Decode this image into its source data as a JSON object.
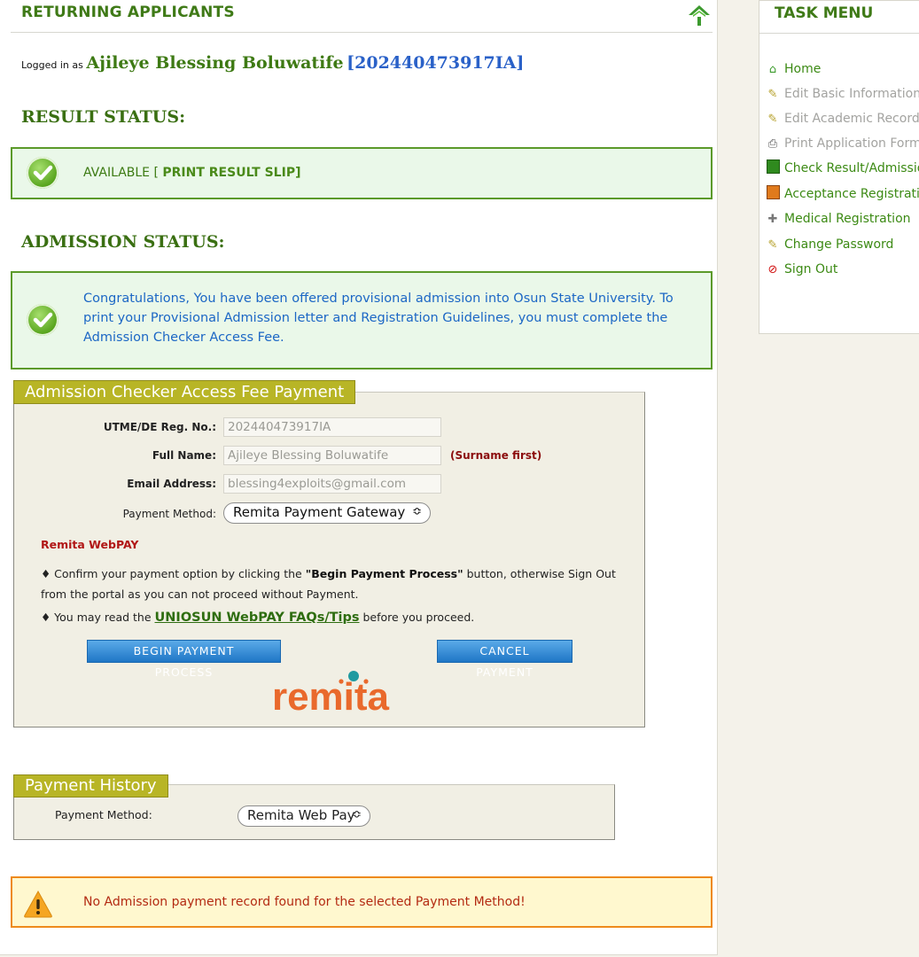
{
  "main": {
    "title": "RETURNING APPLICANTS",
    "logged_in_prefix": "Logged in as",
    "user_name": "Ajileye Blessing Boluwatife",
    "reg_no_display": "[202440473917IA]"
  },
  "result_status": {
    "heading": "RESULT STATUS:",
    "text": "AVAILABLE [",
    "link": "PRINT RESULT SLIP]"
  },
  "admission_status": {
    "heading": "ADMISSION STATUS:",
    "message": "Congratulations, You have been offered provisional admission into Osun State University. To print your Provisional Admission letter and Registration Guidelines, you must complete the Admission Checker Access Fee."
  },
  "fee_form": {
    "title": "Admission Checker Access Fee Payment",
    "reg_label": "UTME/DE Reg. No.:",
    "reg_value": "202440473917IA",
    "name_label": "Full Name:",
    "name_value": "Ajileye Blessing Boluwatife",
    "name_note": "(Surname first)",
    "email_label": "Email Address:",
    "email_value": "blessing4exploits@gmail.com",
    "method_label": "Payment Method:",
    "method_value": "Remita Payment Gateway",
    "webpay_label": "Remita WebPAY",
    "note1_a": "♦ Confirm your payment option by clicking the ",
    "note1_b": "\"Begin Payment Process\"",
    "note1_c": " button, otherwise Sign Out from the portal as you can not proceed without Payment.",
    "note2_a": "♦ You may read the ",
    "note2_link": "UNIOSUN WebPAY FAQs/Tips",
    "note2_b": " before you proceed.",
    "begin_button": "BEGIN PAYMENT PROCESS",
    "cancel_button": "CANCEL PAYMENT",
    "logo_text": "remita"
  },
  "payment_history": {
    "title": "Payment History",
    "method_label": "Payment Method:",
    "method_value": "Remita Web Pay"
  },
  "warning": {
    "text": "No Admission payment record found for the selected Payment Method!"
  },
  "task_menu": {
    "title": "TASK MENU",
    "items": [
      {
        "label": "Home",
        "icon": "home-icon"
      },
      {
        "label": "Edit Basic Information",
        "icon": "pencil-icon"
      },
      {
        "label": "Edit Academic Records",
        "icon": "pencil-icon"
      },
      {
        "label": "Print Application Form",
        "icon": "printer-icon"
      },
      {
        "label": "Check Result/Admission",
        "icon": "book-green-icon"
      },
      {
        "label": "Acceptance Registration",
        "icon": "book-orange-icon"
      },
      {
        "label": "Medical Registration",
        "icon": "medical-icon"
      },
      {
        "label": "Change Password",
        "icon": "pencil-icon"
      },
      {
        "label": "Sign Out",
        "icon": "no-entry-icon"
      }
    ]
  },
  "colors": {
    "brand_green": "#3f7a17",
    "tab_olive": "#b8b526",
    "link_blue": "#1c67c5",
    "warning_orange": "#ee8a1c"
  }
}
